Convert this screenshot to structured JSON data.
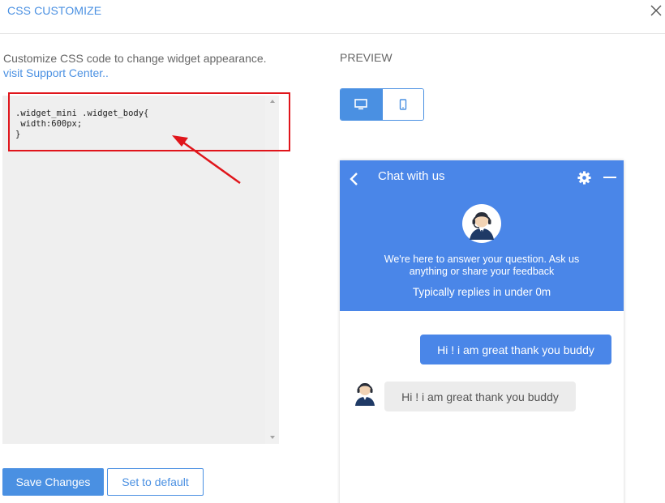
{
  "modal": {
    "title": "CSS CUSTOMIZE",
    "close_icon": "close-icon"
  },
  "editor": {
    "description": "Customize CSS code to change widget appearance.",
    "support_link": "visit Support Center..",
    "code": ".widget_mini .widget_body{\n width:600px;\n}"
  },
  "actions": {
    "save_label": "Save Changes",
    "default_label": "Set to default"
  },
  "preview": {
    "label": "PREVIEW",
    "devices": [
      "desktop-icon",
      "mobile-icon"
    ],
    "active_device": "desktop"
  },
  "chat": {
    "title": "Chat with us",
    "welcome": "We're here to answer your question. Ask us anything or share your feedback",
    "replies": "Typically replies in under 0m",
    "messages": [
      {
        "direction": "outgoing",
        "text": "Hi ! i am great thank you buddy"
      },
      {
        "direction": "incoming",
        "text": "Hi ! i am great thank you buddy"
      }
    ]
  },
  "colors": {
    "accent": "#4a90e2",
    "chat_header": "#4a86e8",
    "annotation": "#e0151b",
    "editor_bg": "#efefef",
    "incoming_bubble": "#ececec"
  }
}
